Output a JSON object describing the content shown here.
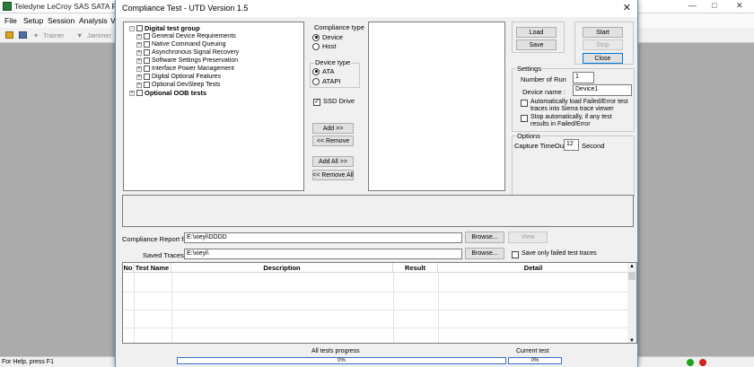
{
  "background_app": {
    "title": "Teledyne LeCroy SAS SATA Proto",
    "menu": [
      "File",
      "Setup",
      "Session",
      "Analysis",
      "V"
    ],
    "toolbar": {
      "trainer_label": "Trainer",
      "jammer_label": "Jammer"
    },
    "status_text": "For Help, press F1",
    "led_colors": [
      "#1fa31f",
      "#d42020"
    ]
  },
  "dialog": {
    "title": "Compliance Test - UTD Version 1.5",
    "tree": [
      {
        "label": "Digital test group",
        "bold": true,
        "expander": "-",
        "level": 0
      },
      {
        "label": "General Device Requirements",
        "bold": false,
        "expander": "+",
        "level": 1
      },
      {
        "label": "Native Command Queuing",
        "bold": false,
        "expander": "+",
        "level": 1
      },
      {
        "label": "Asynchronous Signal Recovery",
        "bold": false,
        "expander": "+",
        "level": 1
      },
      {
        "label": "Software Settings Preservation",
        "bold": false,
        "expander": "+",
        "level": 1
      },
      {
        "label": "Interface Power Management",
        "bold": false,
        "expander": "+",
        "level": 1
      },
      {
        "label": "Digital Optional Features",
        "bold": false,
        "expander": "+",
        "level": 1
      },
      {
        "label": "Optional DevSleep Tests",
        "bold": false,
        "expander": "+",
        "level": 1
      },
      {
        "label": "Optional OOB tests",
        "bold": true,
        "expander": "+",
        "level": 0
      }
    ],
    "compliance_type": {
      "title": "Compliance type",
      "options": [
        "Device",
        "Host"
      ],
      "selected": "Device"
    },
    "device_type": {
      "title": "Device type",
      "options": [
        "ATA",
        "ATAPI"
      ],
      "selected": "ATA"
    },
    "ssd_drive": {
      "label": "SSD Drive",
      "checked": true
    },
    "buttons": {
      "add": "Add  >>",
      "remove": "<< Remove",
      "add_all": "Add All >>",
      "remove_all": "<< Remove All",
      "load": "Load",
      "save": "Save",
      "start": "Start",
      "stop": "Stop",
      "close": "Close",
      "browse": "Browse...",
      "view": "View"
    },
    "settings": {
      "title": "Settings",
      "number_of_run_label": "Number of Run",
      "number_of_run": "1",
      "device_name_label": "Device name :",
      "device_name": "Device1",
      "auto_load_label": "Automatically load Failed/Error test traces into Sierra trace viewer",
      "auto_load_checked": false,
      "auto_stop_label": "Stop automatically, if any test results in Failed/Error",
      "auto_stop_checked": false
    },
    "options": {
      "title": "Options",
      "capture_timeout_label": "Capture TimeOut",
      "capture_timeout": "12",
      "capture_timeout_unit": "Second"
    },
    "report_file": {
      "label": "Compliance Report file",
      "value": "E:\\xieyi\\DDDD"
    },
    "saved_traces": {
      "label": "Saved Traces",
      "value": "E:\\xieyi\\",
      "failed_only_label": "Save only failed test traces",
      "failed_only_checked": false
    },
    "table": {
      "columns": [
        "No",
        "Test Name",
        "Description",
        "Result",
        "Detail"
      ]
    },
    "progress": {
      "all_label": "All tests progress",
      "all_value": "0%",
      "current_label": "Current test",
      "current_value": "0%"
    }
  }
}
